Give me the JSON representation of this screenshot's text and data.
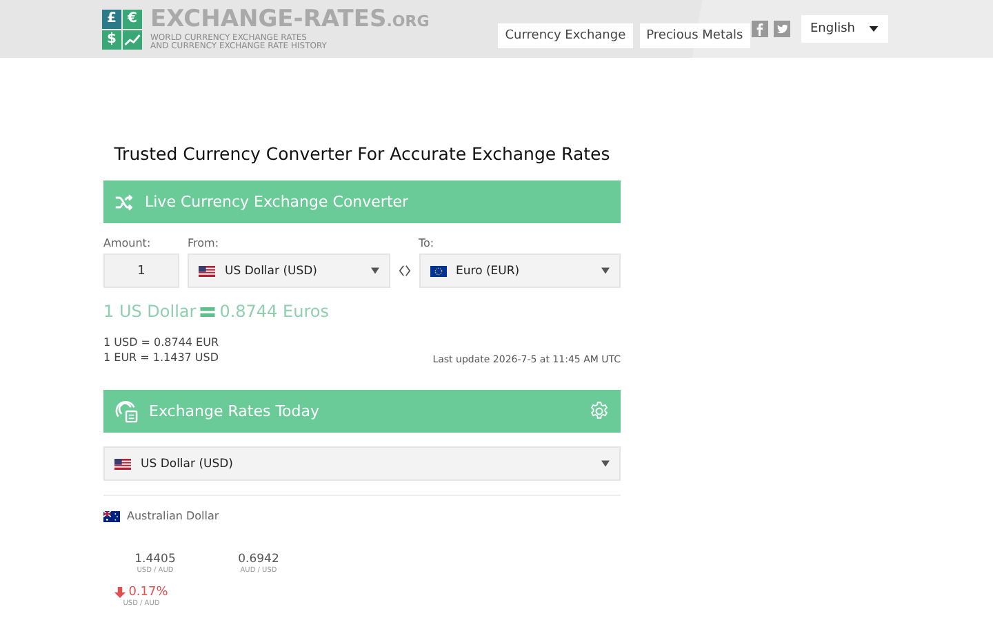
{
  "header": {
    "logo": {
      "tiles": [
        "£",
        "€",
        "$"
      ],
      "name": "EXCHANGE-RATES",
      "suffix": ".ORG",
      "tagline": [
        "WORLD CURRENCY EXCHANGE RATES",
        "AND CURRENCY EXCHANGE RATE HISTORY"
      ]
    },
    "nav": [
      {
        "label": "Currency Exchange"
      },
      {
        "label": "Precious Metals"
      }
    ],
    "language": {
      "value": "English"
    }
  },
  "title": "Trusted Currency Converter For Accurate Exchange Rates",
  "converter": {
    "title": "Live Currency Exchange Converter",
    "amount_label": "Amount:",
    "amount": "1",
    "from_label": "From:",
    "from": {
      "kind": "us",
      "label": "US Dollar (USD)"
    },
    "to_label": "To:",
    "to": {
      "kind": "eu",
      "label": "Euro (EUR)"
    },
    "result": {
      "from_text": "1 US Dollar",
      "to_text": "0.8744 Euros"
    },
    "rates": [
      "1 USD = 0.8744 EUR",
      "1 EUR = 1.1437 USD"
    ],
    "last_update": "Last update 2026-7-5 at 11:45 AM UTC"
  },
  "rates_today": {
    "title": "Exchange Rates Today",
    "select": {
      "kind": "us",
      "label": "US Dollar (USD)"
    },
    "currencies": [
      {
        "kind": "au",
        "name": "Australian Dollar",
        "values": [
          {
            "value": "1.4405",
            "pair": "USD / AUD"
          },
          {
            "value": "0.6942",
            "pair": "AUD / USD"
          }
        ],
        "change": {
          "kind": "down",
          "value": "0.17%",
          "pair": "USD / AUD"
        }
      }
    ]
  }
}
